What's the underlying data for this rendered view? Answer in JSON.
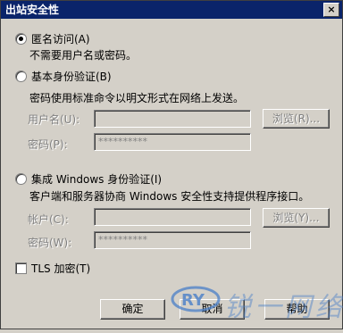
{
  "window": {
    "title": "出站安全性",
    "close_glyph": "×"
  },
  "anonymous": {
    "label": "匿名访问(A)",
    "desc": "不需要用户名或密码。",
    "selected": true
  },
  "basic": {
    "label": "基本身份验证(B)",
    "desc": "密码使用标准命令以明文形式在网络上发送。",
    "user_label": "用户名(U):",
    "user_value": "",
    "pwd_label": "密码(P):",
    "pwd_value": "**********",
    "browse_label": "浏览(R)..."
  },
  "integrated": {
    "label": "集成 Windows 身份验证(I)",
    "desc": "客户端和服务器协商 Windows 安全性支持提供程序接口。",
    "account_label": "帐户(C):",
    "account_value": "",
    "pwd_label": "密码(W):",
    "pwd_value": "**********",
    "browse_label": "浏览(Y)..."
  },
  "tls": {
    "label": "TLS 加密(T)",
    "checked": false
  },
  "buttons": {
    "ok": "确定",
    "cancel": "取消",
    "help": "帮助"
  },
  "watermark": {
    "logo_text": "RY",
    "text": "锐一网络",
    "color": "#4a7fc8"
  }
}
